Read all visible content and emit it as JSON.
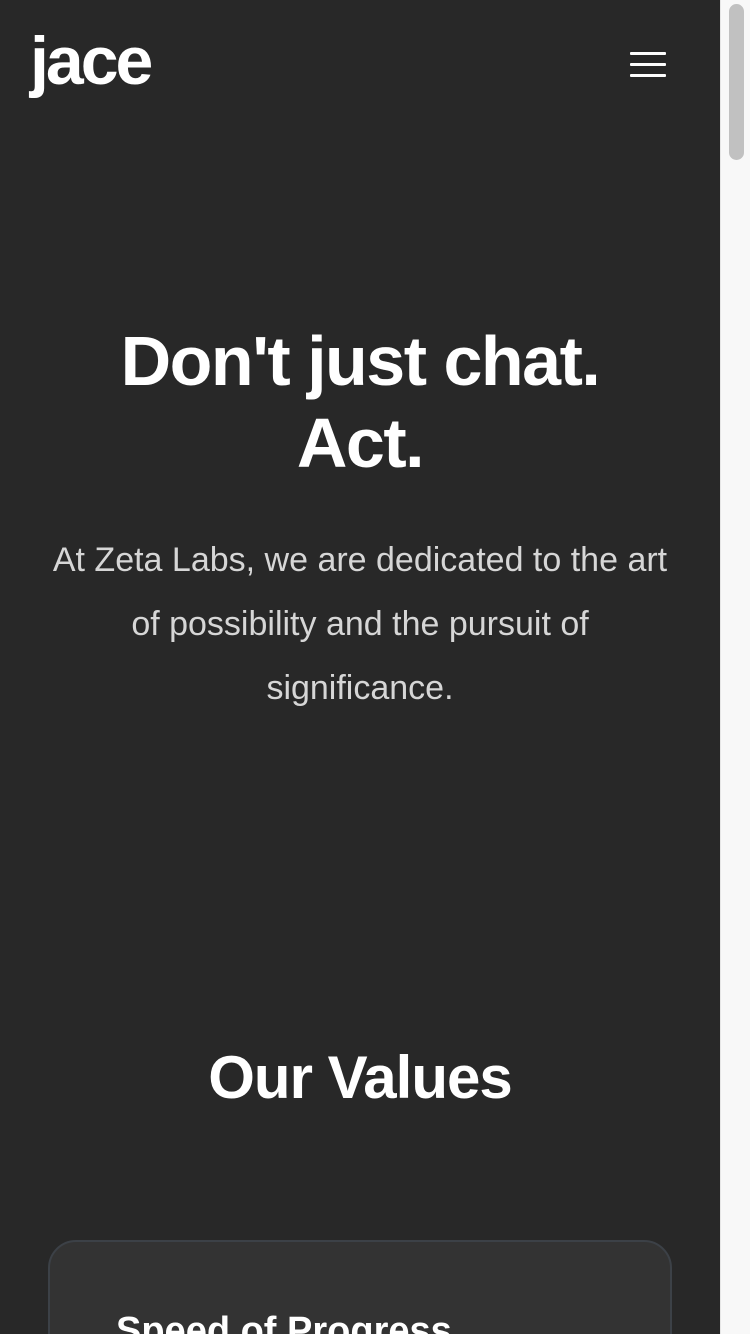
{
  "brand": {
    "logo": "jace"
  },
  "header": {
    "menu_icon": "hamburger-menu-icon"
  },
  "hero": {
    "title_line1": "Don't just chat.",
    "title_line2": "Act.",
    "subtitle": "At Zeta Labs, we are dedicated to the art of possibility and the pursuit of significance."
  },
  "values": {
    "heading": "Our Values",
    "cards": [
      {
        "title": "Speed of Progress"
      }
    ]
  },
  "colors": {
    "background": "#282828",
    "text": "#ffffff",
    "subtitle_text": "#d6d6d6",
    "card_background": "#333333",
    "card_border": "#3c4147"
  }
}
